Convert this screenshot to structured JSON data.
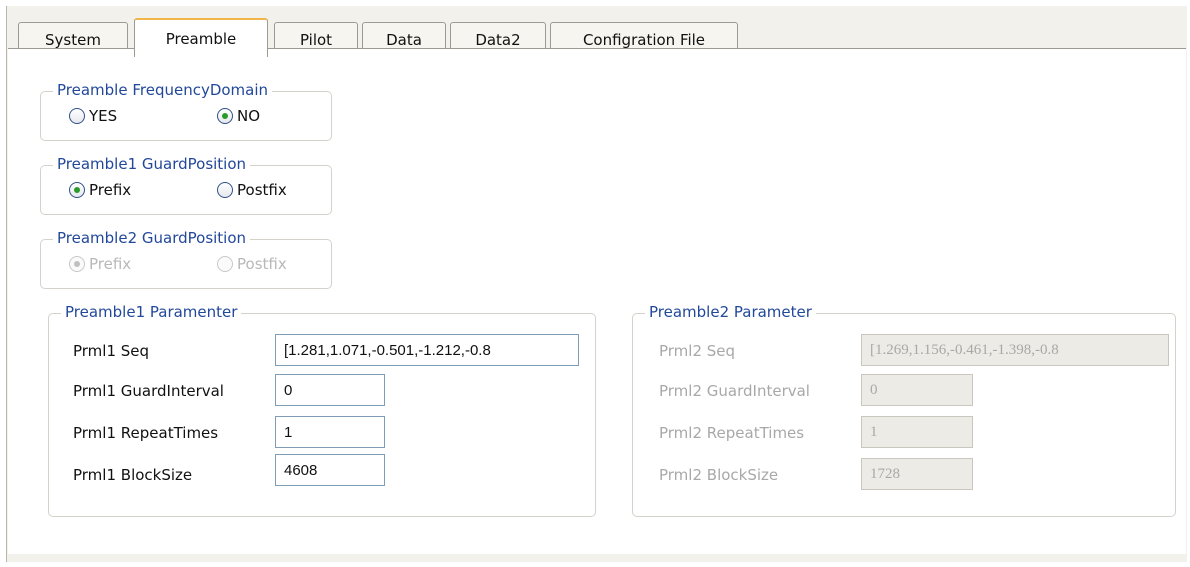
{
  "tabs": [
    {
      "label": "System"
    },
    {
      "label": "Preamble"
    },
    {
      "label": "Pilot"
    },
    {
      "label": "Data"
    },
    {
      "label": "Data2"
    },
    {
      "label": "Configration File"
    }
  ],
  "active_tab": "Preamble",
  "freq_domain": {
    "legend": "Preamble FrequencyDomain",
    "options": [
      {
        "label": "YES",
        "checked": false
      },
      {
        "label": "NO",
        "checked": true
      }
    ]
  },
  "p1_guard": {
    "legend": "Preamble1 GuardPosition",
    "options": [
      {
        "label": "Prefix",
        "checked": true
      },
      {
        "label": "Postfix",
        "checked": false
      }
    ]
  },
  "p2_guard": {
    "legend": "Preamble2 GuardPosition",
    "enabled": false,
    "options": [
      {
        "label": "Prefix",
        "checked": true
      },
      {
        "label": "Postfix",
        "checked": false
      }
    ]
  },
  "p1_params": {
    "legend": "Preamble1 Paramenter",
    "fields": [
      {
        "label": "Prml1 Seq",
        "value": "[1.281,1.071,-0.501,-1.212,-0.8"
      },
      {
        "label": "Prml1 GuardInterval",
        "value": "0"
      },
      {
        "label": "Prml1 RepeatTimes",
        "value": "1"
      },
      {
        "label": "Prml1 BlockSize",
        "value": "4608"
      }
    ]
  },
  "p2_params": {
    "legend": "Preamble2 Parameter",
    "enabled": false,
    "fields": [
      {
        "label": "Prml2 Seq",
        "value": "[1.269,1.156,-0.461,-1.398,-0.8"
      },
      {
        "label": "Prml2 GuardInterval",
        "value": "0"
      },
      {
        "label": "Prml2 RepeatTimes",
        "value": "1"
      },
      {
        "label": "Prml2 BlockSize",
        "value": "1728"
      }
    ]
  },
  "colors": {
    "active_tab_accent": "#f1b649",
    "legend_text": "#22489a",
    "radio_checked_dot": "#2a9a2a",
    "disabled_text": "#a8a8a8"
  }
}
